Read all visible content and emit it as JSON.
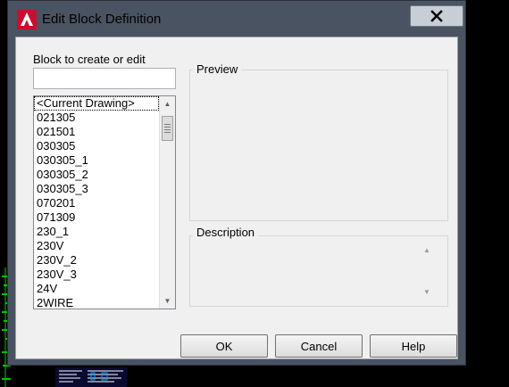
{
  "window": {
    "title": "Edit Block Definition",
    "close_glyph": "✕"
  },
  "form": {
    "block_label": "Block to create or edit",
    "block_input_value": ""
  },
  "block_list": {
    "items": [
      "<Current Drawing>",
      "021305",
      "021501",
      "030305",
      "030305_1",
      "030305_2",
      "030305_3",
      "070201",
      "071309",
      "230_1",
      "230V",
      "230V_2",
      "230V_3",
      "24V",
      "2WIRE"
    ],
    "selected_index": 0
  },
  "groups": {
    "preview_label": "Preview",
    "description_label": "Description"
  },
  "buttons": {
    "ok": "OK",
    "cancel": "Cancel",
    "help": "Help"
  },
  "colors": {
    "titlebar": "#4a5361",
    "app_icon_red": "#c8102e",
    "cad_green": "#00ff00"
  },
  "icons": {
    "app": "autocad-logo-icon",
    "close": "close-icon"
  }
}
